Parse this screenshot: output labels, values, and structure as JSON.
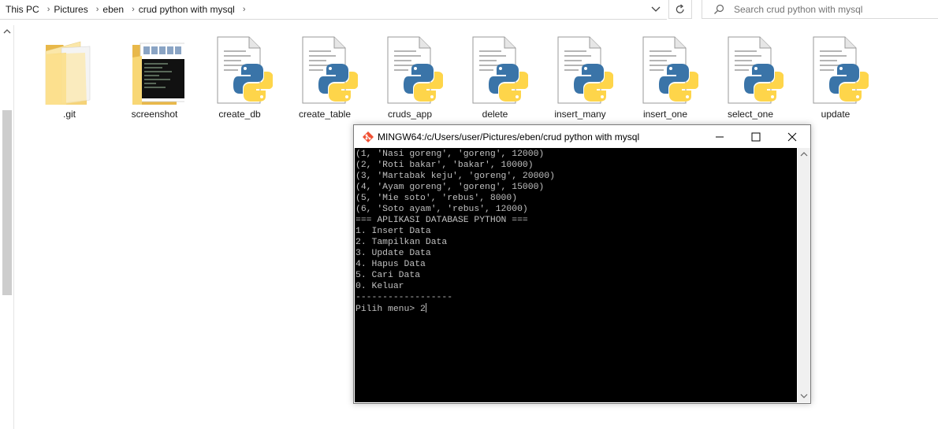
{
  "explorer": {
    "breadcrumb": [
      "This PC",
      "Pictures",
      "eben",
      "crud python with mysql"
    ],
    "search_placeholder": "Search crud python with mysql",
    "files": [
      {
        "name": ".git",
        "icon": "folder-icon"
      },
      {
        "name": "screenshot",
        "icon": "folder-thumbnail-icon"
      },
      {
        "name": "create_db",
        "icon": "python-file-icon"
      },
      {
        "name": "create_table",
        "icon": "python-file-icon"
      },
      {
        "name": "cruds_app",
        "icon": "python-file-icon"
      },
      {
        "name": "delete",
        "icon": "python-file-icon"
      },
      {
        "name": "insert_many",
        "icon": "python-file-icon"
      },
      {
        "name": "insert_one",
        "icon": "python-file-icon"
      },
      {
        "name": "select_one",
        "icon": "python-file-icon"
      },
      {
        "name": "update",
        "icon": "python-file-icon"
      }
    ]
  },
  "terminal": {
    "title": "MINGW64:/c/Users/user/Pictures/eben/crud python with mysql",
    "lines": [
      "(1, 'Nasi goreng', 'goreng', 12000)",
      "(2, 'Roti bakar', 'bakar', 10000)",
      "(3, 'Martabak keju', 'goreng', 20000)",
      "(4, 'Ayam goreng', 'goreng', 15000)",
      "(5, 'Mie soto', 'rebus', 8000)",
      "(6, 'Soto ayam', 'rebus', 12000)",
      "=== APLIKASI DATABASE PYTHON ===",
      "1. Insert Data",
      "2. Tampilkan Data",
      "3. Update Data",
      "4. Hapus Data",
      "5. Cari Data",
      "0. Keluar",
      "------------------"
    ],
    "prompt": "Pilih menu> 2"
  },
  "colors": {
    "terminal_bg": "#000000",
    "terminal_fg": "#c0c0c0",
    "folder": "#f8d775",
    "python_blue": "#3a74a8",
    "python_yellow": "#fed54a"
  }
}
